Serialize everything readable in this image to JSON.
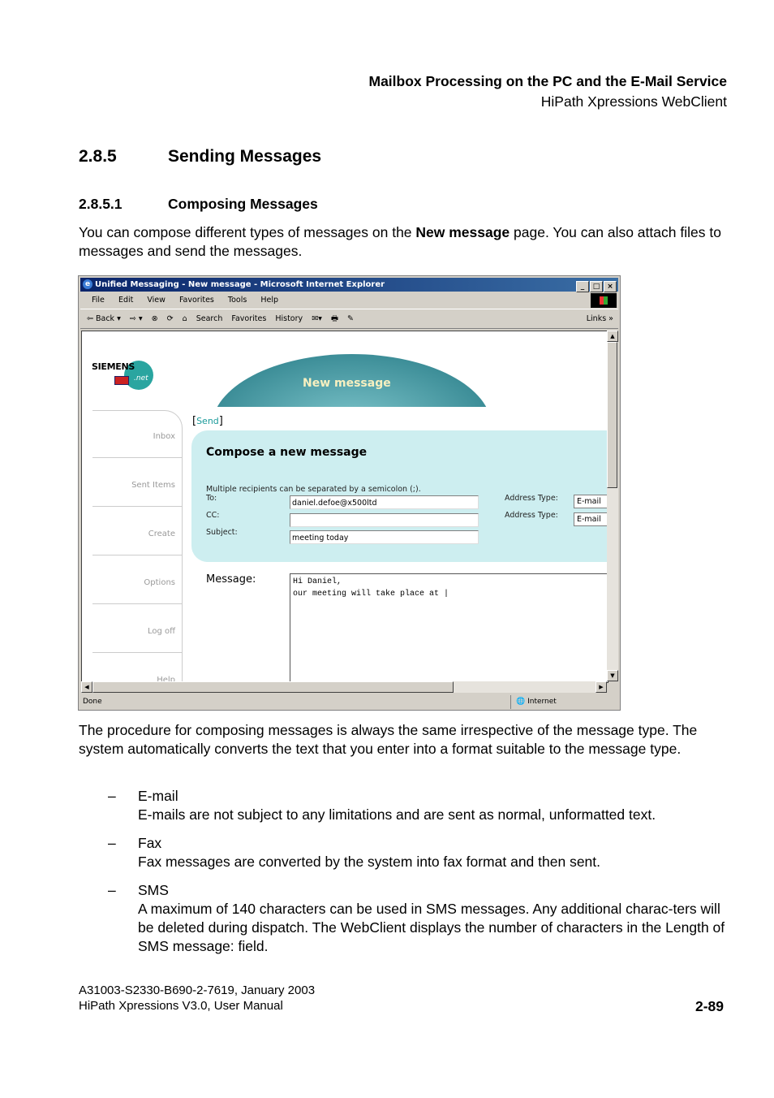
{
  "header": {
    "title": "Mailbox Processing on the PC and the E-Mail Service",
    "subtitle": "HiPath Xpressions WebClient"
  },
  "section": {
    "number": "2.8.5",
    "title": "Sending Messages"
  },
  "subsection": {
    "number": "2.8.5.1",
    "title": "Composing Messages"
  },
  "intro": {
    "before": "You can compose different types of messages on the ",
    "bold": "New message",
    "after": " page. You can also attach files to messages and send the messages."
  },
  "screenshot": {
    "window_title": "Unified Messaging - New message - Microsoft Internet Explorer",
    "window_buttons": [
      "_",
      "□",
      "×"
    ],
    "menu": [
      "File",
      "Edit",
      "View",
      "Favorites",
      "Tools",
      "Help"
    ],
    "toolbar": [
      "⇦ Back ▾",
      "⇨ ▾",
      "⊗",
      "⟳",
      "⌂",
      "Search",
      "Favorites",
      "History",
      "✉▾",
      "🖶",
      "✎"
    ],
    "links_label": "Links »",
    "logo": {
      "brand": "SIEMENS",
      "suffix": ".net"
    },
    "banner_title": "New message",
    "nav": [
      "Inbox",
      "Sent Items",
      "Create",
      "Options",
      "Log off",
      "Help"
    ],
    "send_link": "Send",
    "compose": {
      "title": "Compose a new message",
      "hint": "Multiple recipients can be separated by a semicolon (;).",
      "to_label": "To:",
      "to_value": "daniel.defoe@x500ltd",
      "cc_label": "CC:",
      "cc_value": "",
      "subject_label": "Subject:",
      "subject_value": "meeting today",
      "address_type_label": "Address Type:",
      "address_type_to": "E-mail",
      "address_type_cc": "E-mail"
    },
    "message_label": "Message:",
    "message_value": "Hi Daniel,\nour meeting will take place at |",
    "status_text": "Done",
    "status_zone": "Internet"
  },
  "procedure_text": "The procedure for composing messages is always the same irrespective of the message type. The system automatically converts the text that you enter into a format suitable to the message type.",
  "types": [
    {
      "dash": "–",
      "title": "E-mail",
      "text": "E-mails are not subject to any limitations and are sent as normal, unformatted text."
    },
    {
      "dash": "–",
      "title": "Fax",
      "text": "Fax messages are converted by the system into fax format and then sent."
    },
    {
      "dash": "–",
      "title": "SMS",
      "text": "A maximum of 140 characters can be used in SMS messages. Any additional charac-ters will be deleted during dispatch. The WebClient displays the number of characters in the Length of SMS message: field."
    }
  ],
  "footer": {
    "doc_id": "A31003-S2330-B690-2-7619, January 2003",
    "manual": "HiPath Xpressions V3.0, User Manual",
    "page": "2-89"
  }
}
